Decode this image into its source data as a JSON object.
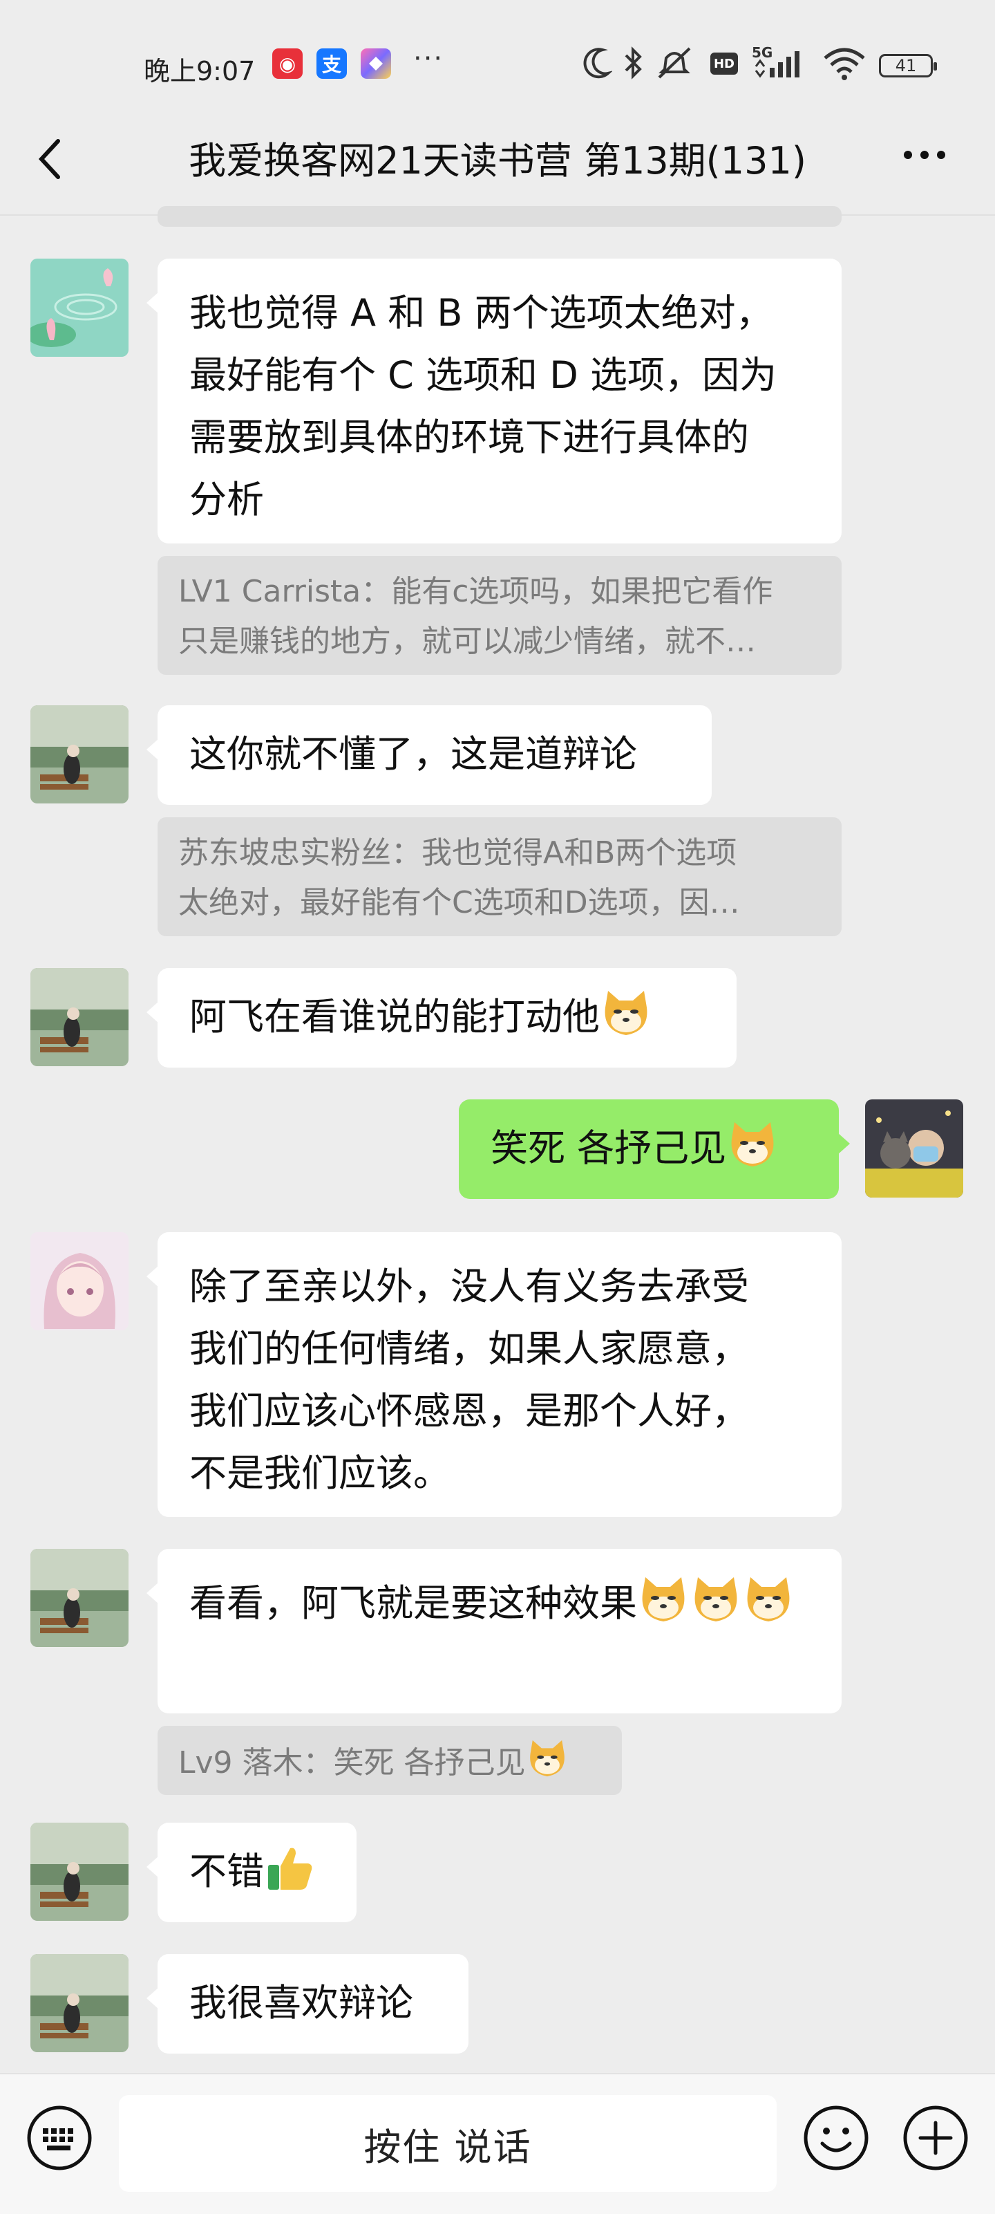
{
  "status_bar": {
    "time": "晚上9:07",
    "icons": [
      "netease-music-icon",
      "alipay-icon",
      "app-icon",
      "more-dots",
      "moon-icon",
      "bluetooth-icon",
      "mute-icon",
      "hd-icon",
      "signal-5g-icon",
      "wifi-icon",
      "battery-icon"
    ],
    "app_icon_1": "◉",
    "app_icon_2": "支",
    "more": "···",
    "network": "5G",
    "hd": "HD",
    "battery": "41"
  },
  "header": {
    "title": "我爱换客网21天读书营 第13期(131)"
  },
  "messages": [
    {
      "sender": "other",
      "text": "我也觉得 A 和 B 两个选项太绝对，最好能有个 C 选项和 D 选项，因为需要放到具体的环境下进行具体的分析",
      "lines": [
        "我也觉得 A 和 B 两个选项太绝对，",
        "最好能有个 C 选项和 D 选项，因为",
        "需要放到具体的环境下进行具体的",
        "分析"
      ]
    },
    {
      "quote_lines": [
        "LV1 Carrista：能有c选项吗，如果把它看作",
        "只是赚钱的地方，就可以减少情绪，就不…"
      ]
    },
    {
      "sender": "other",
      "text": "这你就不懂了，这是道辩论"
    },
    {
      "quote_lines": [
        "苏东坡忠实粉丝：我也觉得A和B两个选项",
        "太绝对，最好能有个C选项和D选项，因…"
      ]
    },
    {
      "sender": "other",
      "text": "阿飞在看谁说的能打动他"
    },
    {
      "sender": "me",
      "text": "笑死 各抒己见"
    },
    {
      "sender": "other",
      "lines": [
        "除了至亲以外，没人有义务去承受",
        "我们的任何情绪，如果人家愿意，",
        "我们应该心怀感恩，是那个人好，",
        "不是我们应该。"
      ]
    },
    {
      "sender": "other",
      "text": "看看，阿飞就是要这种效果"
    },
    {
      "quote": "Lv9 落木：笑死 各抒己见"
    },
    {
      "sender": "other",
      "text": "不错"
    },
    {
      "sender": "other",
      "text": "我很喜欢辩论"
    }
  ],
  "input_bar": {
    "voice_label": "按住 说话",
    "icons": [
      "keyboard-icon",
      "emoji-icon",
      "plus-icon"
    ]
  },
  "colors": {
    "background": "#ededed",
    "my_bubble": "#95ec69",
    "other_bubble": "#ffffff",
    "quote_bg": "#dedede"
  }
}
